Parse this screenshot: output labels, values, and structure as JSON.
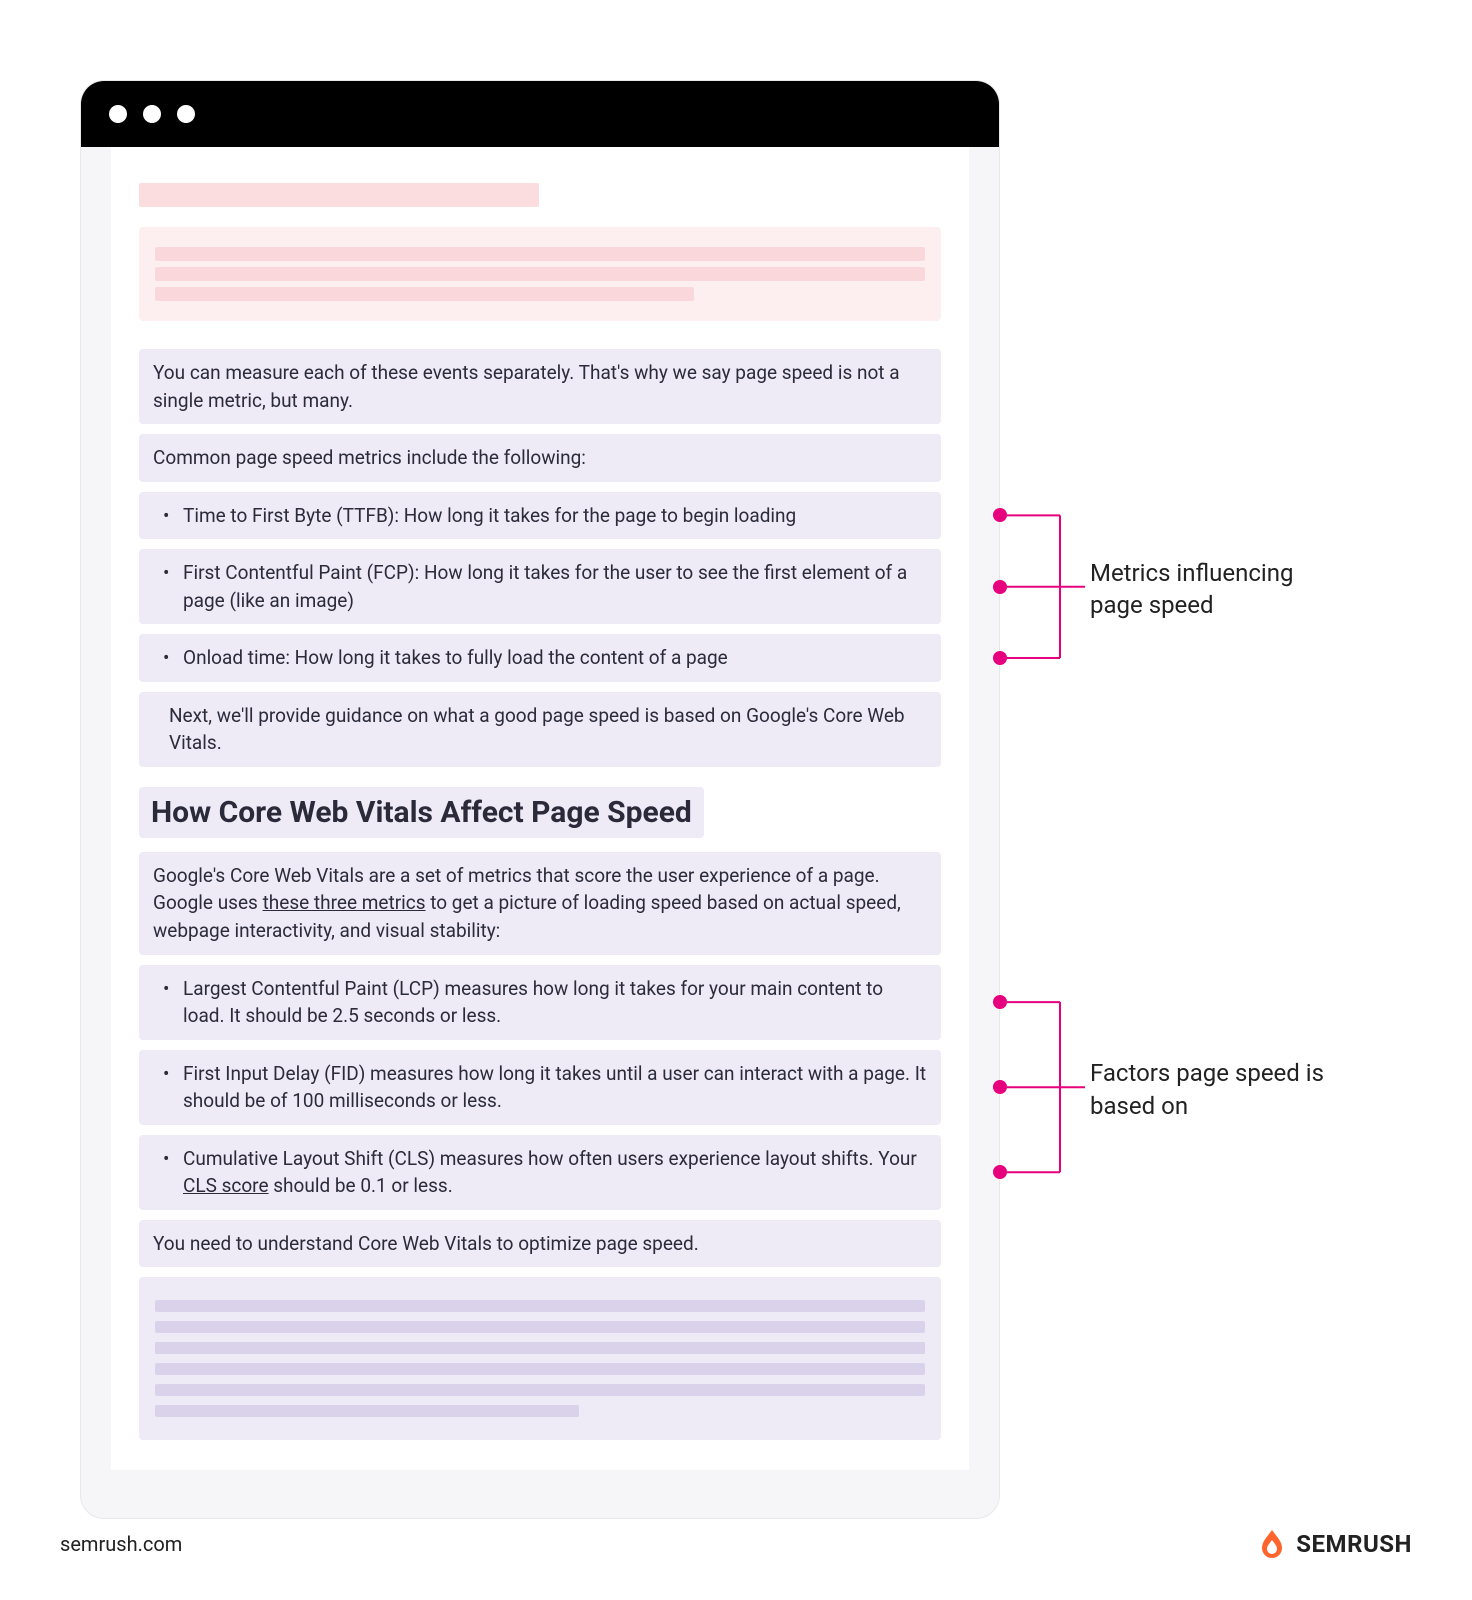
{
  "content": {
    "para1": "You can measure each of these events separately. That's why we say page speed is not a single metric, but many.",
    "para2": "Common page speed metrics include the following:",
    "metrics": [
      "Time to First Byte (TTFB): How long it takes for the page to begin loading",
      "First Contentful Paint (FCP): How long it takes for the user to see the first element of a page (like an image)",
      "Onload time: How long it takes to fully load the content of a page"
    ],
    "para3": "Next, we'll provide guidance on what a good page speed is based on Google's Core Web Vitals.",
    "heading": "How Core Web Vitals Affect Page Speed",
    "para4_a": "Google's Core Web Vitals are a set of metrics that score the user experience of a page. Google uses ",
    "para4_link": "these three metrics",
    "para4_b": " to get a picture of loading speed based on actual speed, webpage interactivity, and visual stability:",
    "factors": [
      {
        "text": "Largest Contentful Paint (LCP) measures how long it takes for your main content to load. It should be 2.5 seconds or less."
      },
      {
        "text": "First Input Delay (FID) measures how long it takes until a user can interact with a page. It should be of 100 milliseconds or less."
      },
      {
        "text_a": "Cumulative Layout Shift (CLS) measures how often users experience layout shifts. Your ",
        "link": "CLS score",
        "text_b": " should be 0.1 or less."
      }
    ],
    "para5": "You need to understand Core Web Vitals to optimize page speed."
  },
  "annotations": {
    "label1": "Metrics influencing page speed",
    "label2": "Factors page speed is based on"
  },
  "footer": {
    "site": "semrush.com",
    "brand": "SEMRUSH"
  },
  "colors": {
    "accent": "#e6007e",
    "highlight": "#eeeaf6",
    "pink": "#fbdde0",
    "brand": "#ff642d"
  }
}
